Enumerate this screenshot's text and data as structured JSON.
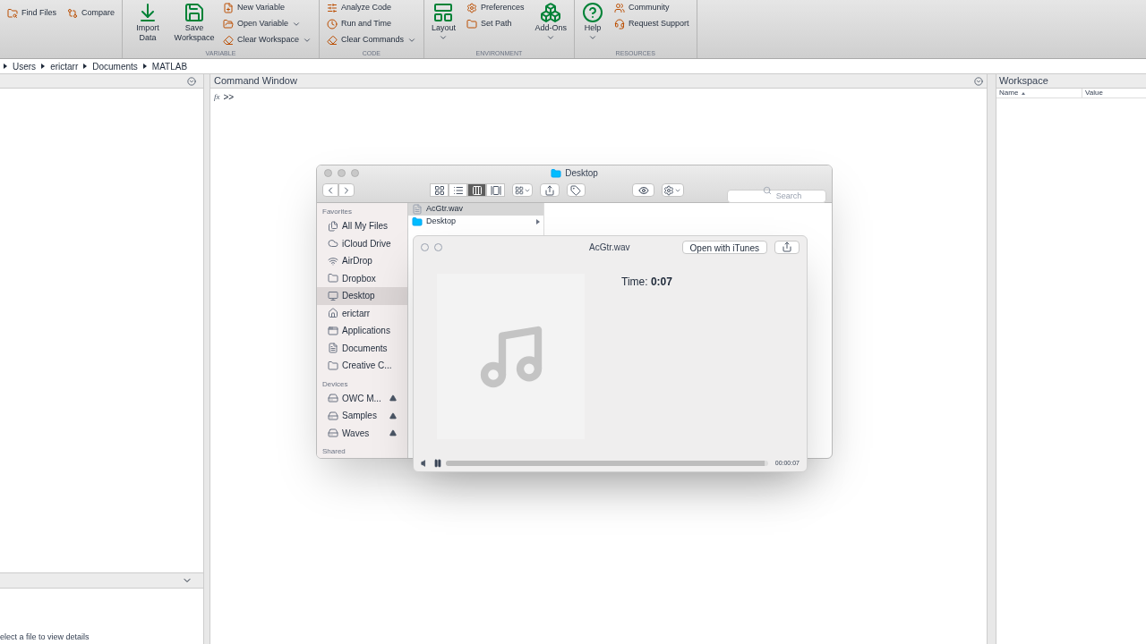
{
  "toolstrip": {
    "sections": [
      {
        "items": [
          {
            "kind": "small",
            "label": "Find Files",
            "dropdown": false
          },
          {
            "kind": "small",
            "label": "Compare",
            "dropdown": false
          }
        ]
      },
      {
        "label": "VARIABLE",
        "items": [
          {
            "kind": "big",
            "label": "Import Data",
            "dropdown": false
          },
          {
            "kind": "big",
            "label": "Save Workspace",
            "dropdown": false
          },
          {
            "kind": "stack",
            "children": [
              {
                "label": "New Variable",
                "dropdown": false
              },
              {
                "label": "Open Variable",
                "dropdown": true
              },
              {
                "label": "Clear Workspace",
                "dropdown": true
              }
            ]
          }
        ]
      },
      {
        "label": "CODE",
        "items": [
          {
            "kind": "stack",
            "children": [
              {
                "label": "Analyze Code",
                "dropdown": false
              },
              {
                "label": "Run and Time",
                "dropdown": false
              },
              {
                "label": "Clear Commands",
                "dropdown": true
              }
            ]
          }
        ]
      },
      {
        "label": "ENVIRONMENT",
        "items": [
          {
            "kind": "big",
            "label": "Layout",
            "dropdown": true
          },
          {
            "kind": "stack",
            "children": [
              {
                "label": "Preferences",
                "dropdown": false
              },
              {
                "label": "Set Path",
                "dropdown": false
              }
            ]
          },
          {
            "kind": "big",
            "label": "Add-Ons",
            "dropdown": true
          }
        ]
      },
      {
        "label": "RESOURCES",
        "items": [
          {
            "kind": "big",
            "label": "Help",
            "dropdown": true
          },
          {
            "kind": "stack",
            "children": [
              {
                "label": "Community",
                "dropdown": false
              },
              {
                "label": "Request Support",
                "dropdown": false
              }
            ]
          }
        ]
      }
    ]
  },
  "path": [
    "Users",
    "erictarr",
    "Documents",
    "MATLAB"
  ],
  "details": {
    "message": "elect a file to view details"
  },
  "command_window": {
    "title": "Command Window",
    "fx": "fx",
    "prompt": ">>"
  },
  "workspace": {
    "title": "Workspace",
    "columns": [
      "Name",
      "Value"
    ]
  },
  "finder": {
    "title": "Desktop",
    "views": [
      {
        "kind": "icons",
        "selected": false
      },
      {
        "kind": "list",
        "selected": false
      },
      {
        "kind": "columns",
        "selected": true
      },
      {
        "kind": "cover",
        "selected": false
      }
    ],
    "search": {
      "placeholder": "Search"
    },
    "sidebar": [
      {
        "heading": "Favorites",
        "items": [
          {
            "label": "All My Files",
            "kind": "files",
            "selected": false
          },
          {
            "label": "iCloud Drive",
            "kind": "cloud",
            "selected": false
          },
          {
            "label": "AirDrop",
            "kind": "airdrop",
            "selected": false
          },
          {
            "label": "Dropbox",
            "kind": "folder",
            "selected": false
          },
          {
            "label": "Desktop",
            "kind": "desktop",
            "selected": true
          },
          {
            "label": "erictarr",
            "kind": "home",
            "selected": false
          },
          {
            "label": "Applications",
            "kind": "apps",
            "selected": false
          },
          {
            "label": "Documents",
            "kind": "docs",
            "selected": false
          },
          {
            "label": "Creative C...",
            "kind": "folder",
            "selected": false
          }
        ]
      },
      {
        "heading": "Devices",
        "items": [
          {
            "label": "OWC M...",
            "kind": "disk",
            "selected": false,
            "eject": true
          },
          {
            "label": "Samples",
            "kind": "disk",
            "selected": false,
            "eject": true
          },
          {
            "label": "Waves",
            "kind": "disk",
            "selected": false,
            "eject": true
          }
        ]
      },
      {
        "heading": "Shared"
      }
    ],
    "column": [
      {
        "label": "AcGtr.wav",
        "kind": "file",
        "selected": true
      },
      {
        "label": "Desktop",
        "kind": "folder",
        "selected": false
      }
    ]
  },
  "quicklook": {
    "title": "AcGtr.wav",
    "open_button": "Open with iTunes",
    "time": "Time: **0:07**",
    "playing": true,
    "level": 0.99,
    "elapsed": "00:00:07"
  }
}
